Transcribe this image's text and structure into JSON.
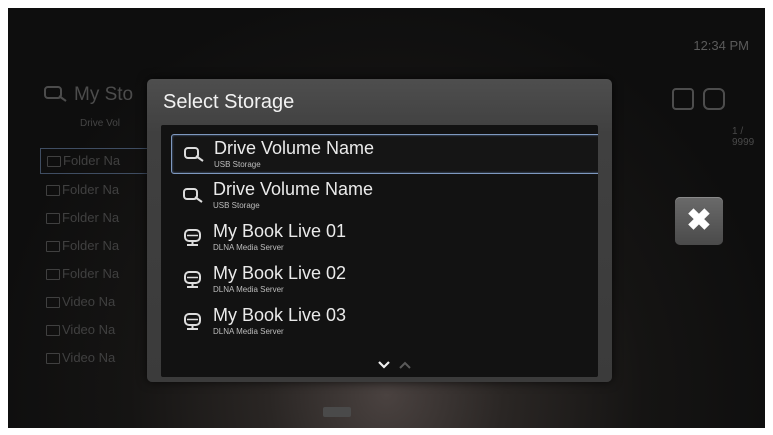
{
  "clock": "12:34 PM",
  "background": {
    "title": "My Sto",
    "subtitle": "Drive Vol",
    "count": "1 / 9999",
    "rows": [
      {
        "label": "Folder Na"
      },
      {
        "label": "Folder Na"
      },
      {
        "label": "Folder Na"
      },
      {
        "label": "Folder Na"
      },
      {
        "label": "Folder Na"
      },
      {
        "label": "Video Na"
      },
      {
        "label": "Video Na"
      },
      {
        "label": "Video Na"
      }
    ]
  },
  "dialog": {
    "title": "Select Storage",
    "items": [
      {
        "name": "Drive Volume Name",
        "type": "USB Storage",
        "icon": "usb-drive-icon",
        "selected": true
      },
      {
        "name": "Drive Volume Name",
        "type": "USB Storage",
        "icon": "usb-drive-icon",
        "selected": false
      },
      {
        "name": "My Book Live 01",
        "type": "DLNA Media Server",
        "icon": "media-server-icon",
        "selected": false
      },
      {
        "name": "My Book Live 02",
        "type": "DLNA Media Server",
        "icon": "media-server-icon",
        "selected": false
      },
      {
        "name": "My Book Live 03",
        "type": "DLNA Media Server",
        "icon": "media-server-icon",
        "selected": false
      }
    ],
    "pager": {
      "down": "⌄",
      "up": "⌃"
    }
  },
  "close_button": {
    "glyph": "✖"
  },
  "colors": {
    "selection_border": "#7e98bf",
    "panel_bg": "#121212",
    "dialog_bg": "#404040"
  }
}
